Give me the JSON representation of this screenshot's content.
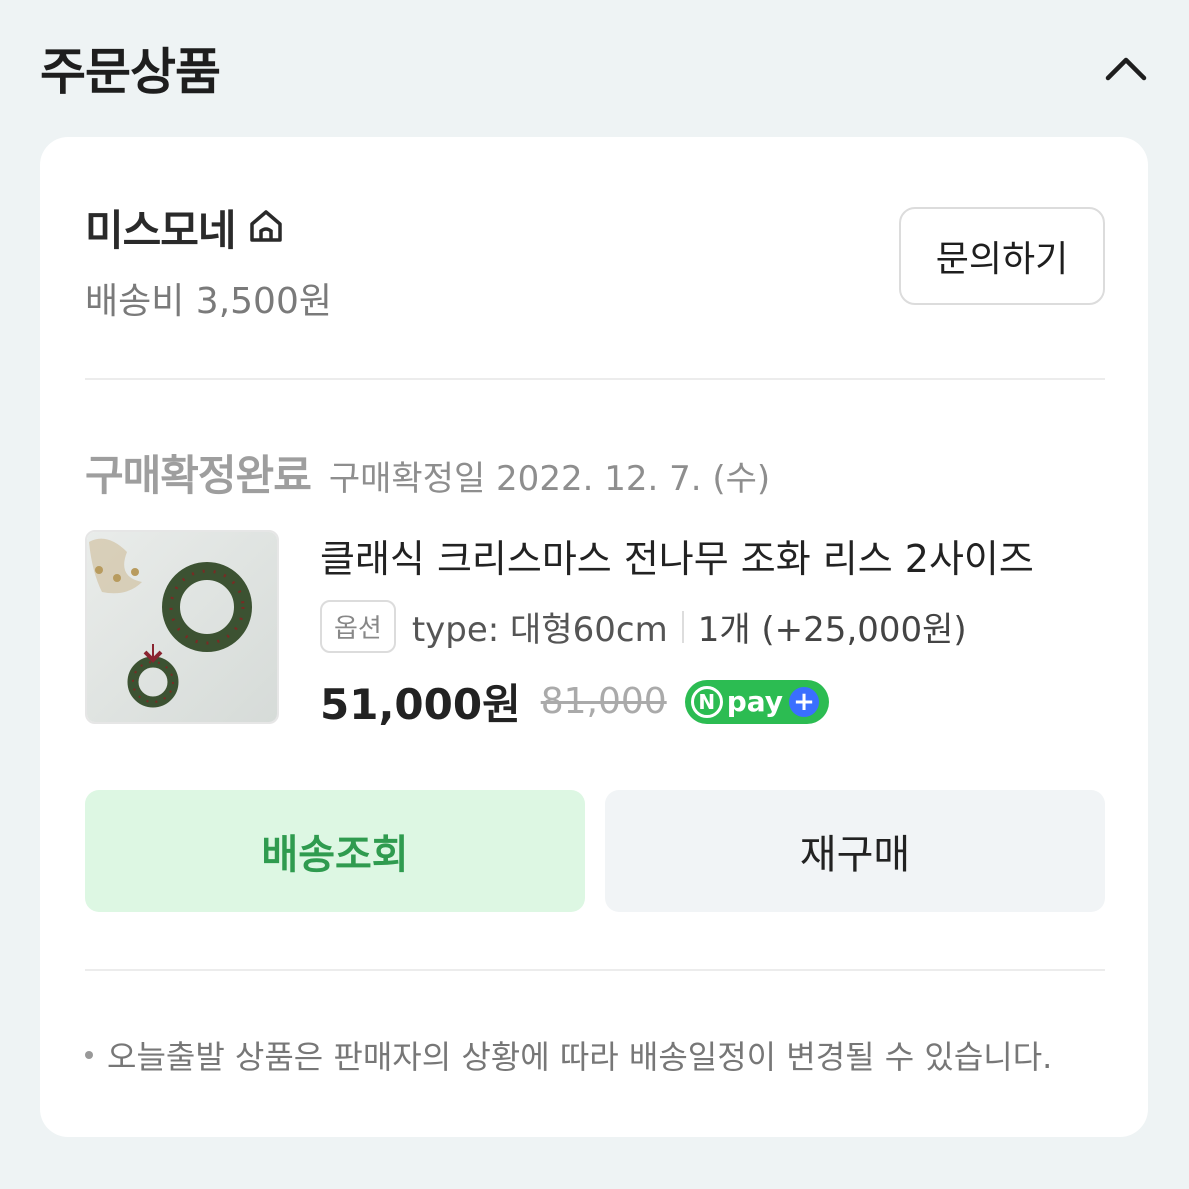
{
  "section": {
    "title": "주문상품"
  },
  "store": {
    "name": "미스모네",
    "shipping_fee": "배송비 3,500원",
    "inquiry_label": "문의하기"
  },
  "order": {
    "status": "구매확정완료",
    "confirm_date": "구매확정일 2022. 12. 7. (수)"
  },
  "product": {
    "name": "클래식 크리스마스 전나무 조화 리스 2사이즈",
    "option_badge": "옵션",
    "option_text": "type: 대형60cm",
    "quantity_text": "1개 (+25,000원)",
    "sale_price": "51,000원",
    "original_price": "81,000",
    "npay_text": "pay",
    "npay_n": "N",
    "npay_plus": "+"
  },
  "actions": {
    "track_label": "배송조회",
    "rebuy_label": "재구매"
  },
  "notice": {
    "text": "오늘출발 상품은 판매자의 상황에 따라 배송일정이 변경될 수 있습니다."
  },
  "colors": {
    "accent_green": "#2f9b4f",
    "track_bg": "#ddf7e3",
    "npay_green": "#2cbc52"
  }
}
